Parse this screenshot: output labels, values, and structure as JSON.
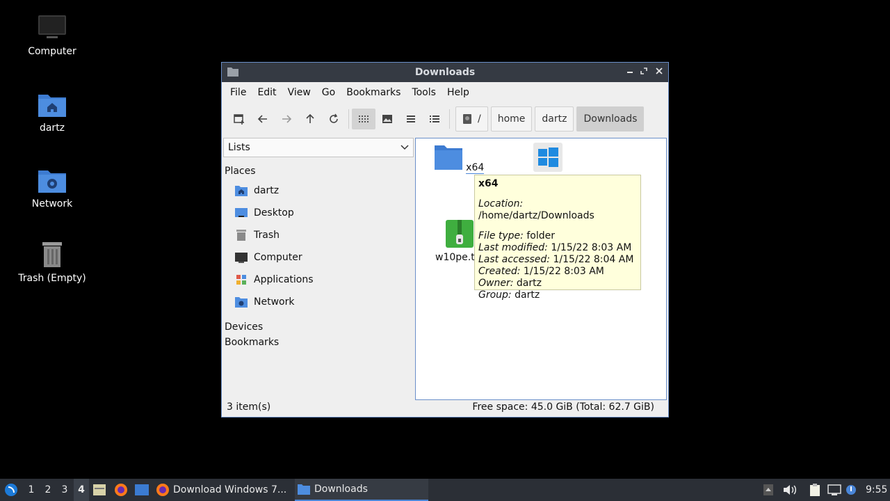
{
  "desktop": {
    "icons": [
      {
        "label": "Computer"
      },
      {
        "label": "dartz"
      },
      {
        "label": "Network"
      },
      {
        "label": "Trash (Empty)"
      }
    ]
  },
  "window": {
    "title": "Downloads",
    "menu": [
      "File",
      "Edit",
      "View",
      "Go",
      "Bookmarks",
      "Tools",
      "Help"
    ],
    "path": {
      "root": "/",
      "segments": [
        "home",
        "dartz",
        "Downloads"
      ]
    },
    "side_combo": "Lists",
    "sections": {
      "places": "Places",
      "devices": "Devices",
      "bookmarks": "Bookmarks"
    },
    "places": [
      "dartz",
      "Desktop",
      "Trash",
      "Computer",
      "Applications",
      "Network"
    ],
    "files": [
      {
        "name": "x64"
      },
      {
        "name": ""
      },
      {
        "name": "w10pe.t"
      }
    ],
    "tooltip": {
      "name": "x64",
      "location_label": "Location:",
      "location": "/home/dartz/Downloads",
      "type_label": "File type:",
      "type": "folder",
      "modified_label": "Last modified:",
      "modified": "1/15/22 8:03 AM",
      "accessed_label": "Last accessed:",
      "accessed": "1/15/22 8:04 AM",
      "created_label": "Created:",
      "created": "1/15/22 8:03 AM",
      "owner_label": "Owner:",
      "owner": "dartz",
      "group_label": "Group:",
      "group": "dartz"
    },
    "status": {
      "items": "3 item(s)",
      "free": "Free space: 45.0 GiB (Total: 62.7 GiB)"
    }
  },
  "taskbar": {
    "workspaces": [
      "1",
      "2",
      "3",
      "4"
    ],
    "tasks": [
      "Download Windows 7...",
      "Downloads"
    ],
    "clock": "9:55"
  },
  "colors": {
    "accent": "#4a86d8",
    "titlebar": "#353a43",
    "taskbar": "#2b2f36",
    "tooltip": "#ffffdc"
  }
}
